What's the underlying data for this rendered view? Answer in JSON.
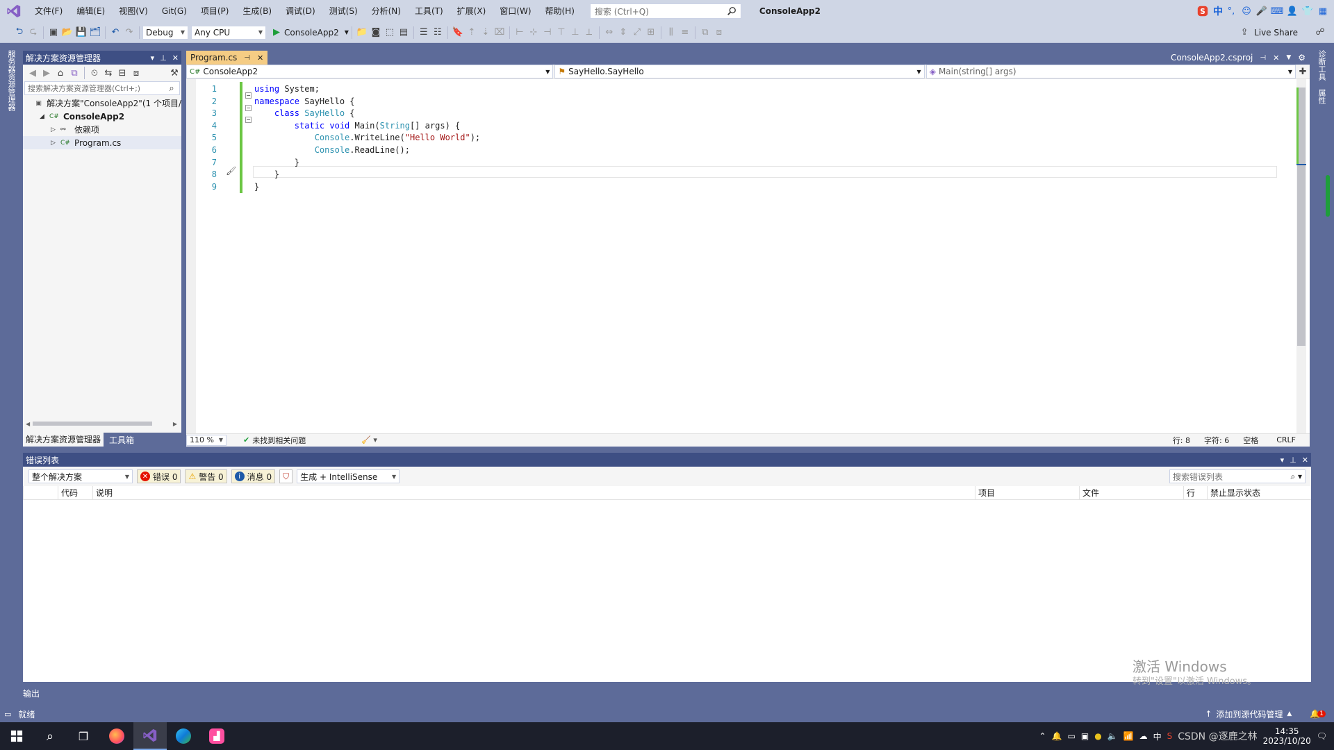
{
  "menubar": {
    "items": [
      "文件(F)",
      "编辑(E)",
      "视图(V)",
      "Git(G)",
      "项目(P)",
      "生成(B)",
      "调试(D)",
      "测试(S)",
      "分析(N)",
      "工具(T)",
      "扩展(X)",
      "窗口(W)",
      "帮助(H)"
    ],
    "search_placeholder": "搜索 (Ctrl+Q)",
    "app_name": "ConsoleApp2"
  },
  "ime": {
    "lang": "中"
  },
  "toolbar": {
    "config": "Debug",
    "platform": "Any CPU",
    "start_target": "ConsoleApp2",
    "live_share": "Live Share"
  },
  "left_strip": {
    "tabs": [
      "服务器资源管理器"
    ]
  },
  "right_strip": {
    "tabs": [
      "诊断工具",
      "属性"
    ]
  },
  "solution_explorer": {
    "title": "解决方案资源管理器",
    "search_placeholder": "搜索解决方案资源管理器(Ctrl+;)",
    "tree": [
      {
        "label": "解决方案\"ConsoleApp2\"(1 个项目/",
        "level": 0,
        "bold": false,
        "expander": "",
        "icon": "solution-icon"
      },
      {
        "label": "ConsoleApp2",
        "level": 1,
        "bold": true,
        "expander": "◢",
        "icon": "csharp-project-icon"
      },
      {
        "label": "依赖项",
        "level": 2,
        "bold": false,
        "expander": "▷",
        "icon": "dependencies-icon"
      },
      {
        "label": "Program.cs",
        "level": 2,
        "bold": false,
        "expander": "▷",
        "icon": "csharp-file-icon",
        "selected": true
      }
    ],
    "bottom_tabs": [
      "解决方案资源管理器",
      "工具箱"
    ]
  },
  "editor": {
    "tab_label": "Program.cs",
    "right_tab_label": "ConsoleApp2.csproj",
    "nav": {
      "project": "ConsoleApp2",
      "type": "SayHello.SayHello",
      "member": "Main(string[] args)"
    },
    "lines": [
      {
        "n": "1",
        "tokens": [
          {
            "t": "using",
            "c": "kw"
          },
          {
            "t": " System;",
            "c": "pl"
          }
        ]
      },
      {
        "n": "2",
        "tokens": [
          {
            "t": "namespace",
            "c": "kw"
          },
          {
            "t": " SayHello {",
            "c": "pl"
          }
        ]
      },
      {
        "n": "3",
        "tokens": [
          {
            "t": "    ",
            "c": "pl"
          },
          {
            "t": "class",
            "c": "kw"
          },
          {
            "t": " ",
            "c": "pl"
          },
          {
            "t": "SayHello",
            "c": "ty"
          },
          {
            "t": " {",
            "c": "pl"
          }
        ]
      },
      {
        "n": "4",
        "tokens": [
          {
            "t": "        ",
            "c": "pl"
          },
          {
            "t": "static void",
            "c": "kw"
          },
          {
            "t": " Main(",
            "c": "pl"
          },
          {
            "t": "String",
            "c": "ty"
          },
          {
            "t": "[] args) {",
            "c": "pl"
          }
        ]
      },
      {
        "n": "5",
        "tokens": [
          {
            "t": "            ",
            "c": "pl"
          },
          {
            "t": "Console",
            "c": "ty"
          },
          {
            "t": ".WriteLine(",
            "c": "pl"
          },
          {
            "t": "\"Hello World\"",
            "c": "st"
          },
          {
            "t": ");",
            "c": "pl"
          }
        ]
      },
      {
        "n": "6",
        "tokens": [
          {
            "t": "            ",
            "c": "pl"
          },
          {
            "t": "Console",
            "c": "ty"
          },
          {
            "t": ".ReadLine();",
            "c": "pl"
          }
        ]
      },
      {
        "n": "7",
        "tokens": [
          {
            "t": "        }",
            "c": "pl"
          }
        ]
      },
      {
        "n": "8",
        "tokens": [
          {
            "t": "    }",
            "c": "pl"
          }
        ]
      },
      {
        "n": "9",
        "tokens": [
          {
            "t": "}",
            "c": "pl"
          }
        ]
      }
    ],
    "status": {
      "zoom": "110 %",
      "issues": "未找到相关问题",
      "line": "行: 8",
      "char": "字符: 6",
      "whitespace": "空格",
      "eol": "CRLF"
    }
  },
  "error_list": {
    "title": "错误列表",
    "scope": "整个解决方案",
    "errors": "错误 0",
    "warnings": "警告 0",
    "messages": "消息 0",
    "build_filter": "生成 + IntelliSense",
    "search_placeholder": "搜索错误列表",
    "columns": [
      "代码",
      "说明",
      "项目",
      "文件",
      "行",
      "禁止显示状态"
    ]
  },
  "output_tab": "输出",
  "statusbar": {
    "ready": "就绪",
    "source_control": "添加到源代码管理",
    "notifications": "1"
  },
  "watermark": {
    "line1": "激活 Windows",
    "line2": "转到\"设置\"以激活 Windows。"
  },
  "taskbar": {
    "time": "14:35",
    "date": "2023/10/20",
    "lang": "中",
    "csdn": "CSDN @逐鹿之林"
  },
  "colors": {
    "accent": "#5d6b99",
    "active_tab": "#f5cc84",
    "vs_purple": "#865fc5"
  }
}
